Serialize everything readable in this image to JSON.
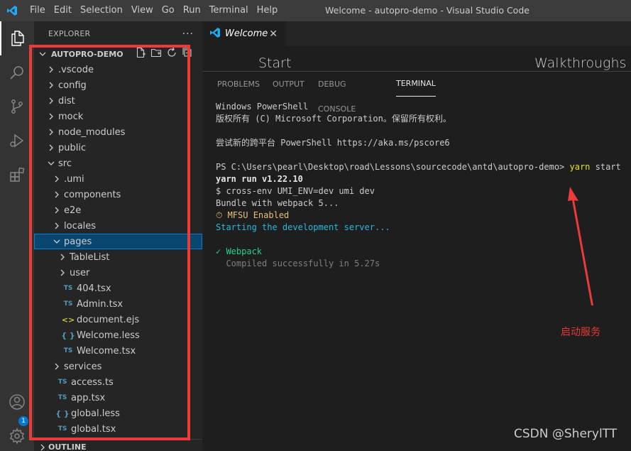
{
  "menu": [
    "File",
    "Edit",
    "Selection",
    "View",
    "Go",
    "Run",
    "Terminal",
    "Help"
  ],
  "window_title": "Welcome - autopro-demo - Visual Studio Code",
  "activity_badge": "1",
  "sidebar": {
    "title": "EXPLORER",
    "more": "···",
    "section": "AUTOPRO-DEMO",
    "outline": "OUTLINE",
    "items": [
      {
        "label": ".vscode",
        "kind": "folder",
        "open": false,
        "level": 1
      },
      {
        "label": "config",
        "kind": "folder",
        "open": false,
        "level": 1
      },
      {
        "label": "dist",
        "kind": "folder",
        "open": false,
        "level": 1
      },
      {
        "label": "mock",
        "kind": "folder",
        "open": false,
        "level": 1
      },
      {
        "label": "node_modules",
        "kind": "folder",
        "open": false,
        "level": 1
      },
      {
        "label": "public",
        "kind": "folder",
        "open": false,
        "level": 1
      },
      {
        "label": "src",
        "kind": "folder",
        "open": true,
        "level": 1
      },
      {
        "label": ".umi",
        "kind": "folder",
        "open": false,
        "level": 2
      },
      {
        "label": "components",
        "kind": "folder",
        "open": false,
        "level": 2
      },
      {
        "label": "e2e",
        "kind": "folder",
        "open": false,
        "level": 2
      },
      {
        "label": "locales",
        "kind": "folder",
        "open": false,
        "level": 2
      },
      {
        "label": "pages",
        "kind": "folder",
        "open": true,
        "level": 2,
        "selected": true
      },
      {
        "label": "TableList",
        "kind": "folder",
        "open": false,
        "level": 3
      },
      {
        "label": "user",
        "kind": "folder",
        "open": false,
        "level": 3
      },
      {
        "label": "404.tsx",
        "kind": "ts",
        "level": 3
      },
      {
        "label": "Admin.tsx",
        "kind": "ts",
        "level": 3
      },
      {
        "label": "document.ejs",
        "kind": "ejs",
        "level": 3
      },
      {
        "label": "Welcome.less",
        "kind": "less",
        "level": 3
      },
      {
        "label": "Welcome.tsx",
        "kind": "ts",
        "level": 3
      },
      {
        "label": "services",
        "kind": "folder",
        "open": false,
        "level": 2
      },
      {
        "label": "access.ts",
        "kind": "ts",
        "level": 2
      },
      {
        "label": "app.tsx",
        "kind": "ts",
        "level": 2
      },
      {
        "label": "global.less",
        "kind": "less",
        "level": 2
      },
      {
        "label": "global.tsx",
        "kind": "ts",
        "level": 2
      }
    ]
  },
  "editor": {
    "tab_label": "Welcome",
    "start": "Start",
    "walkthroughs": "Walkthroughs"
  },
  "panel": {
    "tabs": [
      "PROBLEMS",
      "OUTPUT",
      "DEBUG CONSOLE",
      "TERMINAL"
    ],
    "active_tab": "TERMINAL",
    "lines": {
      "l1": "Windows PowerShell",
      "l2": "版权所有 (C) Microsoft Corporation。保留所有权利。",
      "l3": "尝试新的跨平台 PowerShell https://aka.ms/pscore6",
      "l4_prompt": "PS C:\\Users\\pearl\\Desktop\\road\\Lessons\\sourcecode\\antd\\autopro-demo> ",
      "l4_cmd": "yarn",
      "l4_arg": " start",
      "l5": "yarn run v1.22.10",
      "l6": "$ cross-env UMI_ENV=dev umi dev",
      "l7": "Bundle with webpack 5...",
      "l8": "⏱ MFSU Enabled",
      "l9": "Starting the development server...",
      "l10": "✓ Webpack",
      "l11": "  Compiled successfully in 5.27s"
    }
  },
  "annotation": "启动服务",
  "watermark": "CSDN @SherylTT",
  "colors": {
    "accent": "#007acc",
    "annotation_red": "#e53935",
    "selected_row": "#094771"
  }
}
